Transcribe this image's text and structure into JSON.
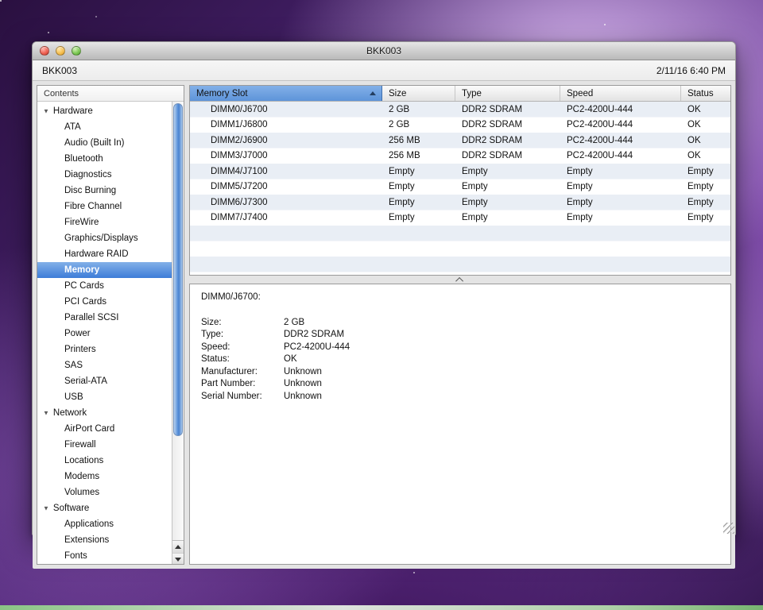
{
  "theme": {
    "highlight_blue": "#3d7cd8",
    "highlight_blue_light": "#82b0e8"
  },
  "window": {
    "title": "BKK003",
    "host": "BKK003",
    "timestamp": "2/11/16 6:40 PM"
  },
  "sidebar": {
    "header": "Contents",
    "selected": "Memory",
    "sections": [
      {
        "label": "Hardware",
        "items": [
          "ATA",
          "Audio (Built In)",
          "Bluetooth",
          "Diagnostics",
          "Disc Burning",
          "Fibre Channel",
          "FireWire",
          "Graphics/Displays",
          "Hardware RAID",
          "Memory",
          "PC Cards",
          "PCI Cards",
          "Parallel SCSI",
          "Power",
          "Printers",
          "SAS",
          "Serial-ATA",
          "USB"
        ]
      },
      {
        "label": "Network",
        "items": [
          "AirPort Card",
          "Firewall",
          "Locations",
          "Modems",
          "Volumes"
        ]
      },
      {
        "label": "Software",
        "items": [
          "Applications",
          "Extensions",
          "Fonts"
        ]
      }
    ]
  },
  "table": {
    "columns": [
      "Memory Slot",
      "Size",
      "Type",
      "Speed",
      "Status"
    ],
    "sort_column": "Memory Slot",
    "sort_direction": "ascending",
    "rows": [
      [
        "DIMM0/J6700",
        "2 GB",
        "DDR2 SDRAM",
        "PC2-4200U-444",
        "OK"
      ],
      [
        "DIMM1/J6800",
        "2 GB",
        "DDR2 SDRAM",
        "PC2-4200U-444",
        "OK"
      ],
      [
        "DIMM2/J6900",
        "256 MB",
        "DDR2 SDRAM",
        "PC2-4200U-444",
        "OK"
      ],
      [
        "DIMM3/J7000",
        "256 MB",
        "DDR2 SDRAM",
        "PC2-4200U-444",
        "OK"
      ],
      [
        "DIMM4/J7100",
        "Empty",
        "Empty",
        "Empty",
        "Empty"
      ],
      [
        "DIMM5/J7200",
        "Empty",
        "Empty",
        "Empty",
        "Empty"
      ],
      [
        "DIMM6/J7300",
        "Empty",
        "Empty",
        "Empty",
        "Empty"
      ],
      [
        "DIMM7/J7400",
        "Empty",
        "Empty",
        "Empty",
        "Empty"
      ]
    ]
  },
  "detail": {
    "title": "DIMM0/J6700:",
    "fields": [
      {
        "label": "Size:",
        "value": "2 GB"
      },
      {
        "label": "Type:",
        "value": "DDR2 SDRAM"
      },
      {
        "label": "Speed:",
        "value": "PC2-4200U-444"
      },
      {
        "label": "Status:",
        "value": "OK"
      },
      {
        "label": "Manufacturer:",
        "value": "Unknown"
      },
      {
        "label": "Part Number:",
        "value": "Unknown"
      },
      {
        "label": "Serial Number:",
        "value": "Unknown"
      }
    ]
  }
}
